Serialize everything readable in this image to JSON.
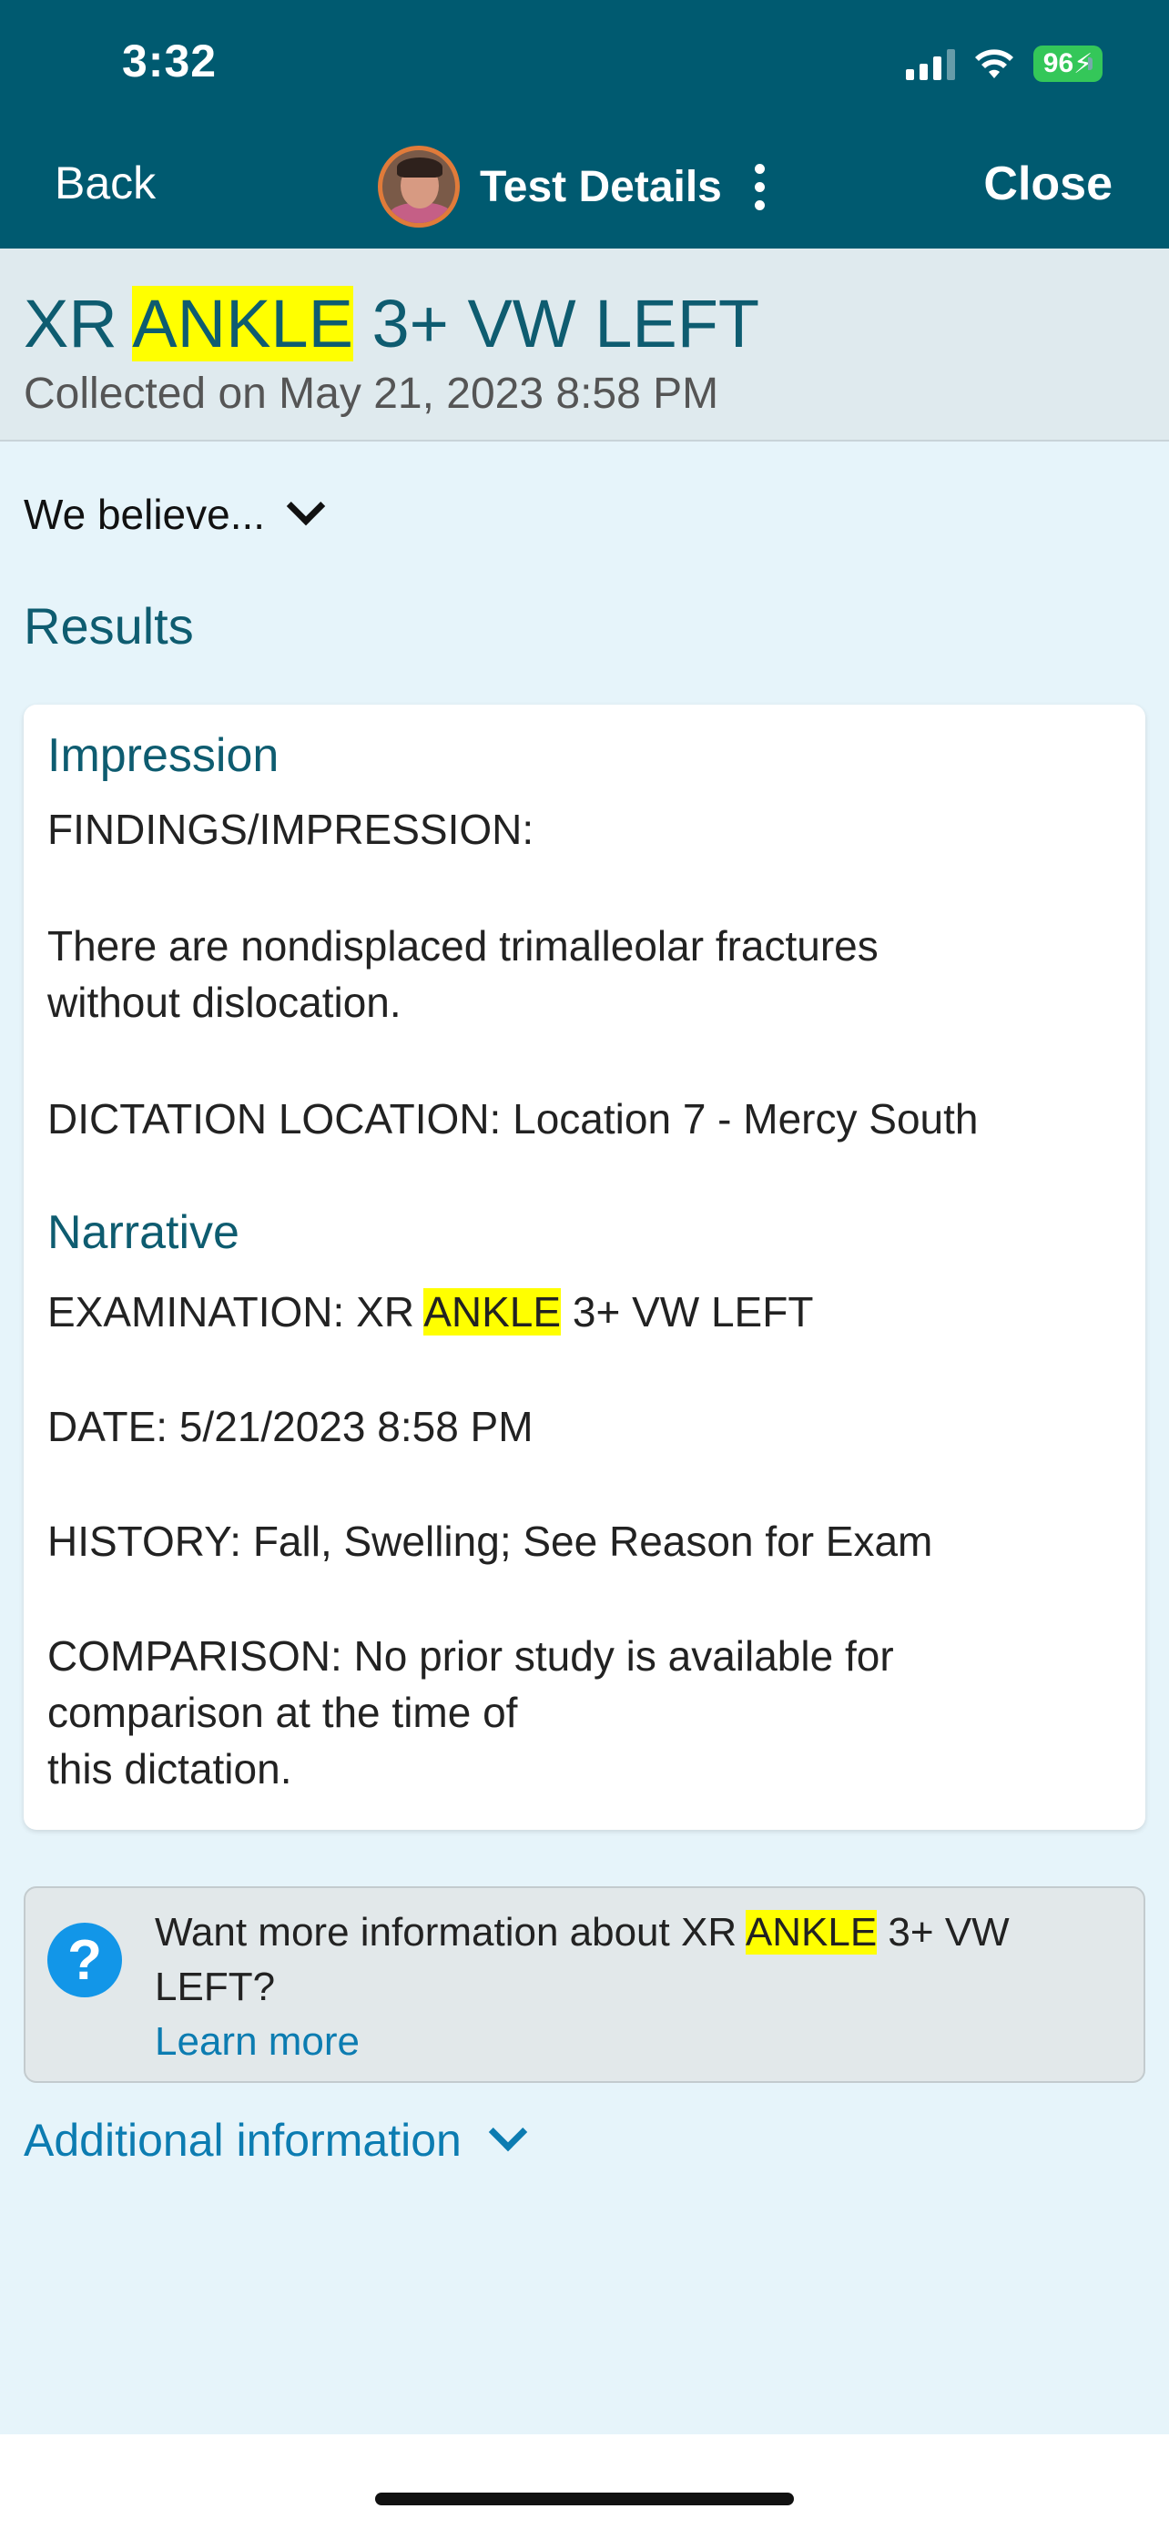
{
  "status_bar": {
    "time": "3:32",
    "battery": "96"
  },
  "nav": {
    "back": "Back",
    "title": "Test Details",
    "close": "Close"
  },
  "test": {
    "title_pre": "XR ",
    "title_hl": "ANKLE",
    "title_post": " 3+ VW LEFT",
    "collected": "Collected on May 21, 2023 8:58 PM"
  },
  "believe_toggle": "We believe...",
  "results_heading": "Results",
  "card": {
    "impression_heading": "Impression",
    "impression_lines": [
      "FINDINGS/IMPRESSION:",
      "There are nondisplaced trimalleolar fractures",
      "without dislocation.",
      "DICTATION LOCATION: Location 7 - Mercy South"
    ],
    "narrative_heading": "Narrative",
    "exam_pre": "EXAMINATION: XR ",
    "exam_hl": "ANKLE",
    "exam_post": " 3+ VW LEFT",
    "narrative_lines": [
      "DATE: 5/21/2023 8:58 PM",
      "HISTORY: Fall, Swelling; See Reason for Exam",
      "COMPARISON: No prior study is available for",
      "comparison at the time of",
      "this dictation."
    ]
  },
  "info": {
    "pre": "Want more information about XR ",
    "hl": "ANKLE",
    "post": " 3+ VW",
    "line2": "LEFT?",
    "learn_more": "Learn more"
  },
  "additional_info": "Additional information"
}
